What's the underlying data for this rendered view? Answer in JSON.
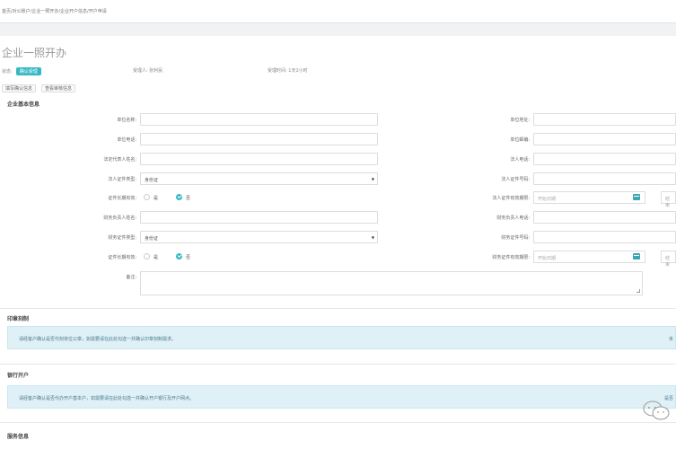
{
  "header": {
    "breadcrumb": "首页/对公账户/企业一照开办/企业开户信息/开户申请"
  },
  "page": {
    "title": "企业一照开办",
    "status_label": "状态:",
    "status_badge": "确认受理",
    "agent_label": "受理人: 张利民",
    "time_label": "受理时间: 1天2小时",
    "tab1": "填写确认信息",
    "tab2": "查看审核信息"
  },
  "basic": {
    "heading": "企业基本信息",
    "unit_name": "单位名称:",
    "unit_phone": "单位电话:",
    "legal_name": "法定代表人姓名:",
    "legal_doc_type": "法人证件类型:",
    "legal_doc_type_value": "身份证",
    "doc_longterm": "证件长期有效:",
    "yes": "是",
    "no": "否",
    "finance_name": "财务负责人姓名:",
    "finance_doc_type": "财务证件类型:",
    "finance_doc_type_value": "身份证",
    "doc_longterm2": "证件长期有效:",
    "remark": "备注:",
    "unit_address": "单位地址:",
    "unit_zip": "单位邮编:",
    "legal_phone": "法人电话:",
    "legal_doc_no": "法人证件号码:",
    "legal_doc_valid": "法人证件有效期限:",
    "finance_phone": "财务负责人电话:",
    "finance_doc_no": "财务证件号码:",
    "finance_doc_valid": "财务证件有效期限:",
    "date_placeholder": "开始日期",
    "date_placeholder2": "结束"
  },
  "seal": {
    "heading": "印章刻制",
    "notice": "请经客户确认是否代刻单位公章，如需要请在此处勾选一并确认印章刻制需求。",
    "right": "未"
  },
  "bank": {
    "heading": "银行开户",
    "notice": "请经客户确认是否代办开户基本户，如需要请在此处勾选一并确认开户银行及开户网点。",
    "right": "是否"
  },
  "service": {
    "heading": "服务信息"
  },
  "colors": {
    "accent": "#35b8c4",
    "info_bg": "#dff0f7"
  }
}
